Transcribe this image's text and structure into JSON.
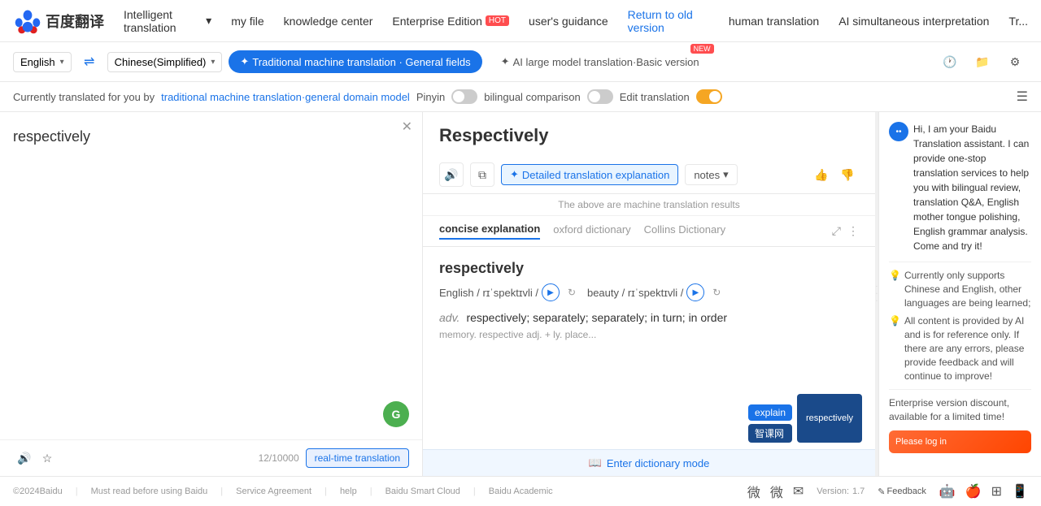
{
  "header": {
    "logo_text": "百度翻译",
    "nav": [
      {
        "id": "intelligent",
        "label": "Intelligent translation",
        "has_dropdown": true
      },
      {
        "id": "myfile",
        "label": "my file"
      },
      {
        "id": "knowledge",
        "label": "knowledge center"
      },
      {
        "id": "enterprise",
        "label": "Enterprise Edition",
        "badge": "HOT"
      },
      {
        "id": "guidance",
        "label": "user's guidance"
      },
      {
        "id": "return",
        "label": "Return to old version",
        "highlight": true
      },
      {
        "id": "human",
        "label": "human translation"
      },
      {
        "id": "ai_interp",
        "label": "AI simultaneous interpretation"
      },
      {
        "id": "trad",
        "label": "Tr..."
      }
    ]
  },
  "toolbar": {
    "source_lang": "English",
    "source_lang_arrow": "▾",
    "target_lang": "Chinese(Simplified)",
    "target_lang_arrow": "▾",
    "swap_icon": "⇌",
    "tabs": [
      {
        "id": "traditional",
        "label": "Traditional machine translation · General fields",
        "active": true,
        "icon": "✦"
      },
      {
        "id": "ai_large",
        "label": "AI large model translation·Basic version",
        "active": false,
        "badge": "NEW",
        "icon": "✦"
      }
    ],
    "icons": [
      {
        "id": "history",
        "icon": "🕐"
      },
      {
        "id": "folder",
        "icon": "📁"
      },
      {
        "id": "settings",
        "icon": "⚙"
      }
    ]
  },
  "infobar": {
    "prefix": "Currently translated for you by",
    "link": "traditional machine translation·general domain model",
    "pinyin_label": "Pinyin",
    "bilingual_label": "bilingual comparison",
    "edit_label": "Edit translation"
  },
  "left_panel": {
    "input_text": "respectively",
    "char_count": "12/10000",
    "audio_icon": "🔊",
    "star_icon": "☆",
    "realtime_label": "real-time translation",
    "grammarly_label": "G"
  },
  "right_panel": {
    "translation": "Respectively",
    "machine_notice": "The above are machine translation results",
    "actions": {
      "audio_icon": "🔊",
      "copy_icon": "⧉",
      "explain_label": "Detailed translation explanation",
      "notes_label": "notes",
      "notes_arrow": "▾",
      "thumbup_icon": "👍",
      "thumbdown_icon": "👎"
    },
    "dict_tabs": [
      {
        "id": "concise",
        "label": "concise explanation",
        "active": true
      },
      {
        "id": "oxford",
        "label": "oxford dictionary",
        "active": false
      },
      {
        "id": "collins",
        "label": "Collins Dictionary",
        "active": false
      }
    ],
    "dict_word": "respectively",
    "phonetics": [
      {
        "label": "English / rɪˈspektɪvli /"
      },
      {
        "label": "beauty / rɪˈspektɪvli /"
      }
    ],
    "pos": [
      {
        "pos": "adv.",
        "def": "respectively; separately; separately; in turn; in order"
      }
    ],
    "dict_subtext": "memory. respective adj. + ly. place...",
    "explain_tag": "explain",
    "zhike_tag": "智课网",
    "dict_mode_label": "Enter dictionary mode",
    "word_preview": "respectively"
  },
  "ai_panel": {
    "avatar_text": "••",
    "intro": "Hi, I am your Baidu Translation assistant. I can provide one-stop translation services to help you with bilingual review, translation Q&A, English mother tongue polishing, English grammar analysis. Come and try it!",
    "tips": [
      {
        "icon": "💡",
        "text": "Currently only supports Chinese and English, other languages are being learned;"
      },
      {
        "icon": "💡",
        "text": "All content is provided by AI and is for reference only. If there are any errors, please provide feedback and will continue to improve!"
      }
    ],
    "promo": "Enterprise version discount, available for a limited time!",
    "promo_banner_text": "Please log in"
  },
  "footer": {
    "copyright": "©2024Baidu",
    "links": [
      {
        "label": "Must read before using Baidu"
      },
      {
        "label": "Service Agreement"
      },
      {
        "label": "help"
      },
      {
        "label": "Baidu Smart Cloud"
      },
      {
        "label": "Baidu Academic"
      }
    ],
    "version_label": "Version:",
    "version_number": "1.7",
    "feedback_label": "Feedback",
    "icons": [
      "weibo",
      "wechat",
      "email",
      "android",
      "apple",
      "windows",
      "appstore"
    ]
  }
}
